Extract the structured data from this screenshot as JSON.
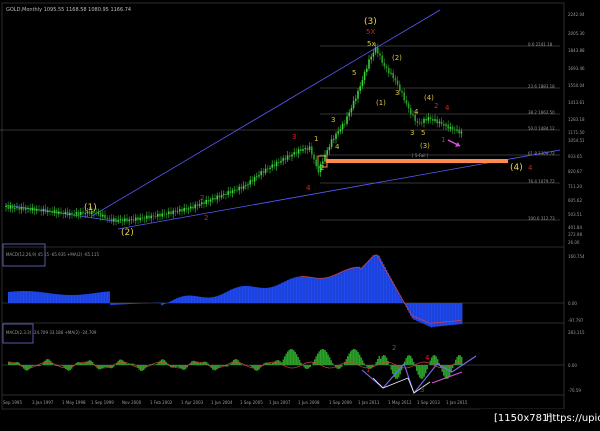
{
  "header": {
    "symbol_line": "GOLD,Monthly  1095.55 1168.58 1080.95 1166.74"
  },
  "indicators": {
    "macd1_label": "MACD(12,26,9) 45 15 -65.935  +MA(2) -65.115",
    "macd2_label": "MACD(2,3,3) -24.709 33.186 +MA(2) -24.709"
  },
  "price_axis": [
    "2242.04",
    "2005.30",
    "1843.88",
    "1693.46",
    "1550.04",
    "1413.61",
    "1283.18",
    "1171.50",
    "1054.51",
    "933.65",
    "820.67",
    "711.20",
    "605.62",
    "503.51",
    "401.84",
    "372.98",
    "26.00"
  ],
  "macd1_axis": [
    "160.754",
    "0.00",
    "-97.797"
  ],
  "macd2_axis": [
    "283.115",
    "0.00",
    "-70.59"
  ],
  "fib_labels": [
    "0.0  2241.18",
    "23.6  1883.18",
    "38.2  1662.50",
    "50.0  1484.12",
    "61.8  1309.72",
    "76.4  1079.72",
    "78.6  1044.87",
    "100.0  312.73"
  ],
  "time_axis": [
    "Sep 1995",
    "3 Jan 1997",
    "1 May 1998",
    "1 Sep 1999",
    "Nov 2000",
    "1 Feb 2002",
    "1 Apr 2003",
    "1 Jun 2004",
    "1 Sep 2005",
    "1 Jan 2007",
    "1 Jun 2008",
    "1 Sep 2009",
    "1 Jan 2011",
    "1 May 2012",
    "1 Sep 2013",
    "1 Jan 2015"
  ],
  "waves": {
    "w1": "(1)",
    "w2": "(2)",
    "w3": "(3)",
    "w4": "(4)",
    "sub1": "1",
    "sub2": "2",
    "sub3": "3",
    "sub4": "4",
    "sub5": "5",
    "big5x": "5x",
    "red5x": "5X",
    "p2": "(2)",
    "p1": "(1)",
    "p3": "(3)",
    "p4": "(4)",
    "r2": "2",
    "r3": "3",
    "r4": "4",
    "r1": "1",
    "r_target": "4",
    "g_b": "4",
    "g_c": "3",
    "box_text": "[ 5-Fail ]",
    "low_a": "3",
    "low_b": "5",
    "macd_r2": "2",
    "macd_r1": "1",
    "macd_r4": "4",
    "macd_r3": "3"
  },
  "footer": {
    "resolution": "[1150x781]",
    "site": "https://upic.me/"
  },
  "colors": {
    "candle": "#3cd23c",
    "macd_hist": "#1f49f2",
    "macd_hist2": "#2aa02a",
    "accent_orange": "#ff8a50",
    "trend": "#5a5aff",
    "label_yellow": "#e6d24a",
    "label_red": "#d62020"
  }
}
